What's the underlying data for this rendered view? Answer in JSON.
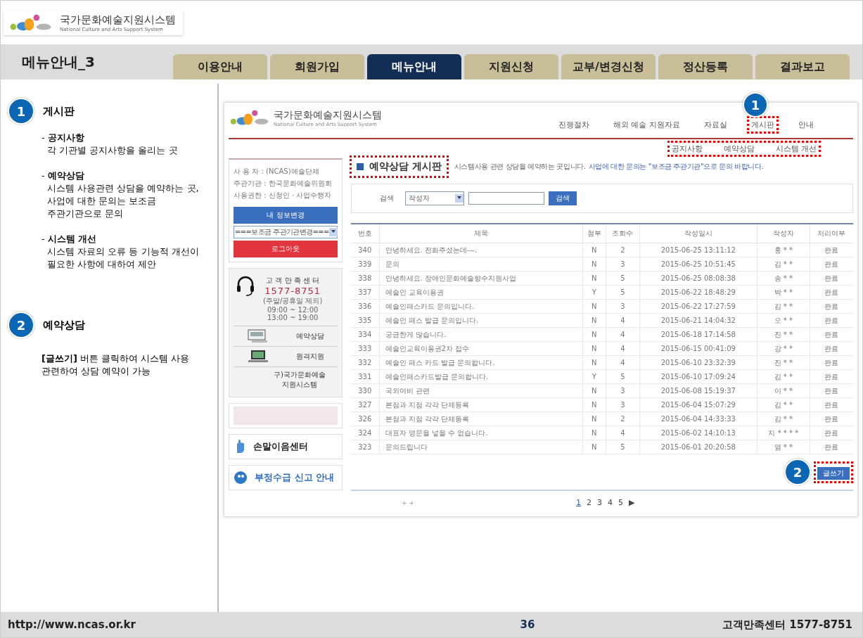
{
  "logo": {
    "title": "국가문화예술지원시스템",
    "subtitle": "National Culture and Arts Support System"
  },
  "page_title": "메뉴안내_3",
  "tabs": [
    {
      "label": "이용안내",
      "selected": false
    },
    {
      "label": "회원가입",
      "selected": false
    },
    {
      "label": "메뉴안내",
      "selected": true
    },
    {
      "label": "지원신청",
      "selected": false
    },
    {
      "label": "교부/변경신청",
      "selected": false
    },
    {
      "label": "정산등록",
      "selected": false
    },
    {
      "label": "결과보고",
      "selected": false
    }
  ],
  "guide": [
    {
      "number": "1",
      "heading": "게시판",
      "items": [
        {
          "label": "- **공지사항**",
          "desc": "각 기관별 공지사항을 올리는 곳"
        },
        {
          "label": "- **예약상담**",
          "desc": "시스템 사용관련 상담을 예약하는 곳, 사업에 대한 문의는 보조금 주관기관으로 문의"
        },
        {
          "label": "- **시스템 개선**",
          "desc": "시스템 자료의 오류 등 기능적 개선이 필요한 사항에 대하여 제안"
        }
      ]
    },
    {
      "number": "2",
      "heading": "예약상담",
      "text": "**[글쓰기]** 버튼 클릭하여 시스템 사용 관련하여 상담 예약이 가능"
    }
  ],
  "site": {
    "logo": {
      "title": "국가문화예술지원시스템",
      "subtitle": "National Culture and Arts Support System"
    },
    "nav": [
      {
        "label": "진행절차",
        "highlighted": false
      },
      {
        "label": "해외 예술 지원자료",
        "highlighted": false
      },
      {
        "label": "자료실",
        "highlighted": false
      },
      {
        "label": "게시판",
        "highlighted": true,
        "callout": "1"
      },
      {
        "label": "안내",
        "highlighted": false
      }
    ],
    "sub_nav": {
      "highlighted": true,
      "items": [
        "공지사항",
        "예약상담",
        "시스템 개선"
      ]
    },
    "user_info": [
      "사 용 자 : (NCAS)예술단체",
      "주관기관 : 한국문화예술위원회",
      "사용권한 : 신청인 · 사업수행자"
    ],
    "my_info_button": "내 정보변경",
    "agency_select": "===보조금 주관기관변경===",
    "logout_button": "로그아웃",
    "support": {
      "title": "고 객 만 족 센 터",
      "phone": "1577-8751",
      "note": "(주말/공휴일 제외)",
      "hours": [
        "09:00 ~ 12:00",
        "13:00 ~ 19:00"
      ],
      "links": [
        {
          "kind": "monitor",
          "label": "예약상담"
        },
        {
          "kind": "laptop",
          "label": "원격지원"
        },
        {
          "kind": "text",
          "label": "구)국가문화예술 지원시스템"
        }
      ]
    },
    "banners": [
      {
        "kind": "image"
      },
      {
        "kind": "sign",
        "label": "손말이음센터"
      },
      {
        "kind": "report",
        "label": "부정수급 신고 안내"
      }
    ],
    "board_title": {
      "text": "예약상담 게시판",
      "highlighted": true
    },
    "description": {
      "text": "시스템사용 관련 상담을 예약하는 곳입니다.",
      "note": "사업에 대한 문의는 \"보조금 주관기관\"으로 문의 바랍니다."
    },
    "search": {
      "label": "검색",
      "option": "작성자",
      "button": "검색"
    },
    "table": {
      "columns": [
        "번호",
        "제목",
        "첨부",
        "조회수",
        "작성일시",
        "작성자",
        "처리여부"
      ],
      "rows": [
        [
          "340",
          "안녕하세요. 전화주셨는데---.",
          "N",
          "2",
          "2015-06-25 13:11:12",
          "홍 * *",
          "완료"
        ],
        [
          "339",
          "문의",
          "N",
          "3",
          "2015-06-25 10:51:45",
          "김 * *",
          "완료"
        ],
        [
          "338",
          "안녕하세요. 장애인문화예술향수지원사업",
          "N",
          "5",
          "2015-06-25 08:08:38",
          "송 * *",
          "완료"
        ],
        [
          "337",
          "예술인 교육이용권",
          "Y",
          "5",
          "2015-06-22 18:48:29",
          "박 * *",
          "완료"
        ],
        [
          "336",
          "예술인패스카드 문의입니다.",
          "N",
          "3",
          "2015-06-22 17:27:59",
          "김 * *",
          "완료"
        ],
        [
          "335",
          "예술인 패스 발급 문의입니다.",
          "N",
          "4",
          "2015-06-21 14:04:32",
          "오 * *",
          "완료"
        ],
        [
          "334",
          "궁금한게 많습니다.",
          "N",
          "4",
          "2015-06-18 17:14:58",
          "진 * *",
          "완료"
        ],
        [
          "333",
          "예술인교육이용권2차 접수",
          "N",
          "4",
          "2015-06-15 00:41:09",
          "강 * *",
          "완료"
        ],
        [
          "332",
          "예술인 패스 카드 발급 문의합니다.",
          "N",
          "4",
          "2015-06-10 23:32:39",
          "진 * *",
          "완료"
        ],
        [
          "331",
          "예술인패스카드발급 문의합니다.",
          "Y",
          "5",
          "2015-06-10 17:09:24",
          "김 * *",
          "완료"
        ],
        [
          "330",
          "국외여비 관련",
          "N",
          "3",
          "2015-06-08 15:19:37",
          "이 * *",
          "완료"
        ],
        [
          "327",
          "본점과 지점 각각 단체등록",
          "N",
          "3",
          "2015-06-04 15:07:29",
          "김 * *",
          "완료"
        ],
        [
          "326",
          "본점과 지점 각각 단체등록",
          "N",
          "2",
          "2015-06-04 14:33:33",
          "김 * *",
          "완료"
        ],
        [
          "324",
          "대표자 영문을 넣을 수 없습니다.",
          "N",
          "4",
          "2015-06-02 14:10:13",
          "지 * * * *",
          "완료"
        ],
        [
          "323",
          "문의드립니다",
          "N",
          "5",
          "2015-06-01 20:20:58",
          "염 * *",
          "완료"
        ]
      ]
    },
    "write_button": {
      "label": "글쓰기",
      "highlighted": true,
      "callout": "2"
    },
    "pager_marks": "+ +",
    "pages": [
      {
        "label": "1",
        "selected": true
      },
      {
        "label": "2",
        "selected": false
      },
      {
        "label": "3",
        "selected": false
      },
      {
        "label": "4",
        "selected": false
      },
      {
        "label": "5",
        "selected": false
      }
    ],
    "next_page": "▶"
  },
  "footer": {
    "url": "http://www.ncas.or.kr",
    "page": "36",
    "contact": "고객만족센터 1577-8751"
  }
}
